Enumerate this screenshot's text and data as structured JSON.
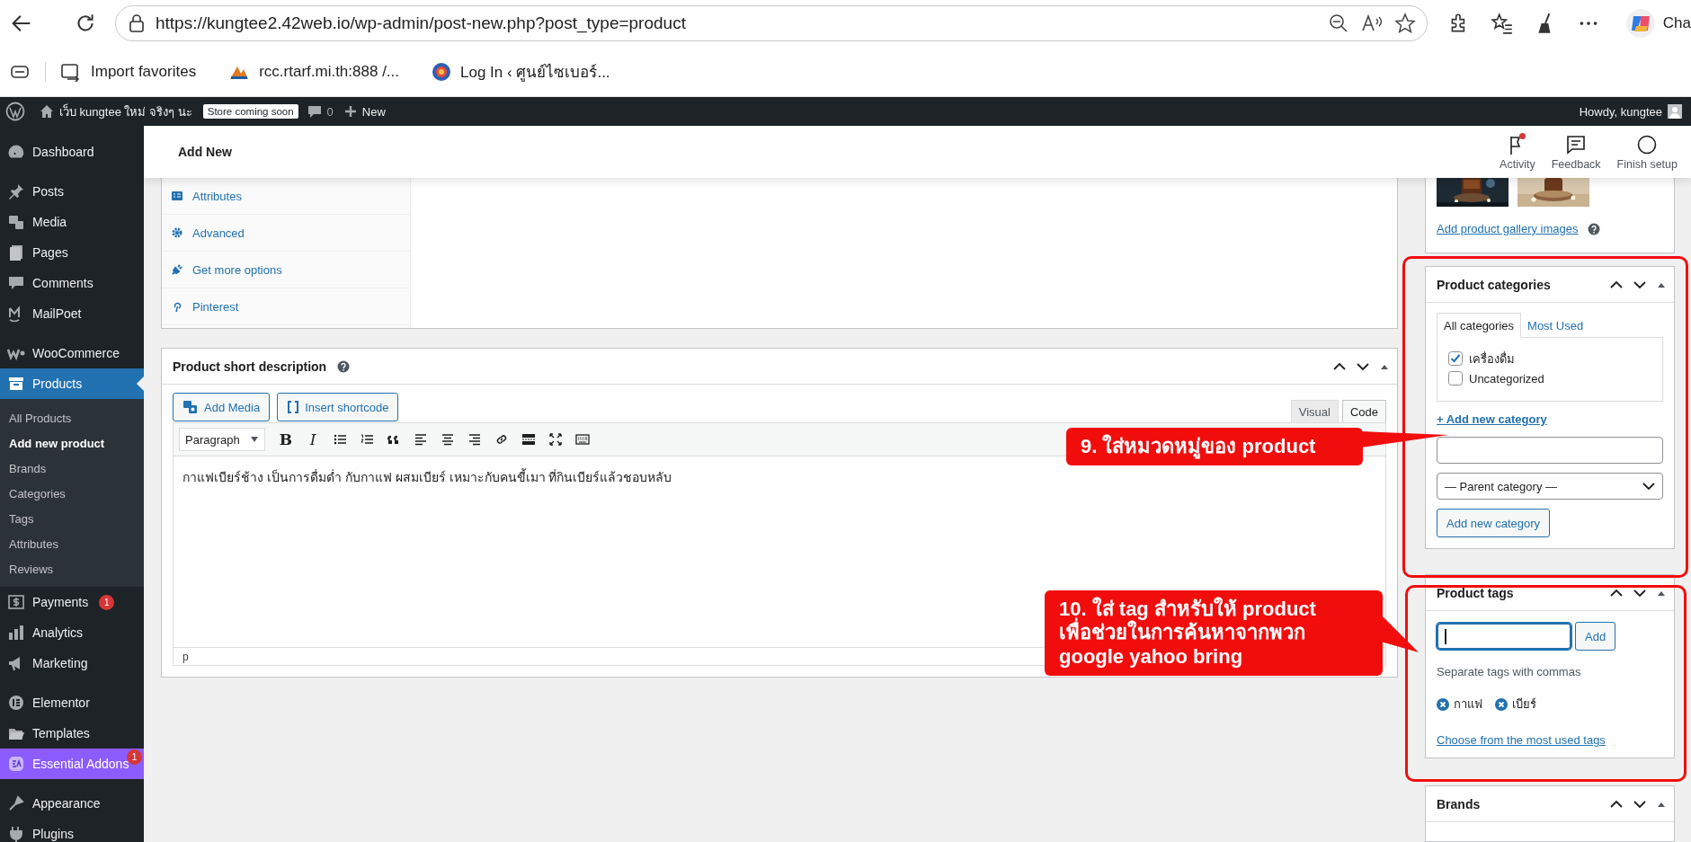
{
  "browser": {
    "url": "https://kungtee2.42web.io/wp-admin/post-new.php?post_type=product",
    "profile_label": "Cha",
    "bookmarks": [
      {
        "label": "Import favorites"
      },
      {
        "label": "rcc.rtarf.mi.th:888 /..."
      },
      {
        "label": "Log In ‹ ศูนย์ไซเบอร์..."
      }
    ]
  },
  "admin_bar": {
    "site_name": "เว็บ kungtee ใหม่ จริงๆ นะ",
    "store_badge": "Store coming soon",
    "comments_count": "0",
    "new_label": "New",
    "greeting": "Howdy, kungtee"
  },
  "sidebar": {
    "groups": [
      [
        {
          "label": "Dashboard",
          "selected": false
        }
      ],
      [
        {
          "label": "Posts",
          "selected": false
        },
        {
          "label": "Media",
          "selected": false
        },
        {
          "label": "Pages",
          "selected": false
        },
        {
          "label": "Comments",
          "selected": false
        },
        {
          "label": "MailPoet",
          "selected": false
        }
      ],
      [
        {
          "label": "WooCommerce",
          "selected": false
        },
        {
          "label": "Products",
          "selected": true,
          "children": [
            {
              "label": "All Products",
              "selected": false
            },
            {
              "label": "Add new product",
              "selected": true
            },
            {
              "label": "Brands",
              "selected": false
            },
            {
              "label": "Categories",
              "selected": false
            },
            {
              "label": "Tags",
              "selected": false
            },
            {
              "label": "Attributes",
              "selected": false
            },
            {
              "label": "Reviews",
              "selected": false
            }
          ]
        },
        {
          "label": "Payments",
          "selected": false,
          "badge": "1"
        },
        {
          "label": "Analytics",
          "selected": false
        },
        {
          "label": "Marketing",
          "selected": false
        }
      ],
      [
        {
          "label": "Elementor",
          "selected": false
        },
        {
          "label": "Templates",
          "selected": false
        },
        {
          "label": "Essential Addons",
          "selected": false,
          "badge": "1",
          "kind": "promo"
        }
      ],
      [
        {
          "label": "Appearance",
          "selected": false
        },
        {
          "label": "Plugins",
          "selected": false
        }
      ]
    ]
  },
  "header": {
    "title": "Add New",
    "actions": [
      {
        "label": "Activity",
        "notification": true
      },
      {
        "label": "Feedback",
        "notification": false
      },
      {
        "label": "Finish setup",
        "notification": false
      }
    ]
  },
  "product_data": {
    "tabs": [
      {
        "label": "Attributes"
      },
      {
        "label": "Advanced"
      },
      {
        "label": "Get more options"
      },
      {
        "label": "Pinterest"
      }
    ]
  },
  "short_description": {
    "title": "Product short description",
    "media_buttons": [
      "Add Media",
      "Insert shortcode"
    ],
    "editor_tabs": [
      {
        "label": "Visual",
        "selected": false
      },
      {
        "label": "Code",
        "selected": true
      }
    ],
    "format": "Paragraph",
    "format_glyphs": [
      "B",
      "I"
    ],
    "content": "กาแฟเบียร์ช้าง เป็นการดื่มด่ำ กับกาแฟ ผสมเบียร์ เหมาะกับคนขี้เมา ที่กินเบียร์แล้วชอบหลับ",
    "path": "p"
  },
  "gallery": {
    "link": "Add product gallery images"
  },
  "categories": {
    "title": "Product categories",
    "tabs": [
      {
        "label": "All categories",
        "selected": true
      },
      {
        "label": "Most Used",
        "selected": false
      }
    ],
    "items": [
      {
        "label": "เครื่องดื่ม",
        "checked": true
      },
      {
        "label": "Uncategorized",
        "checked": false
      }
    ],
    "add_link": "+ Add new category",
    "parent_select": "— Parent category —",
    "add_button": "Add new category"
  },
  "tags": {
    "title": "Product tags",
    "add_button": "Add",
    "hint": "Separate tags with commas",
    "items": [
      "กาแฟ",
      "เบียร์"
    ],
    "link": "Choose from the most used tags"
  },
  "brands": {
    "title": "Brands"
  },
  "annotations": [
    {
      "text": "9. ใส่หมวดหมู่ของ product"
    },
    {
      "text": "10. ใส่ tag สำหรับให้ product\nเพื่อช่วยในการค้นหาจากพวก\ngoogle yahoo bring"
    }
  ]
}
